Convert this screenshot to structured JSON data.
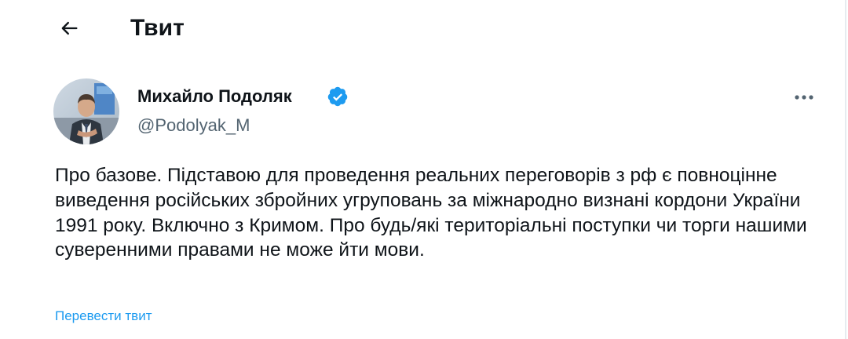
{
  "header": {
    "title": "Твит",
    "back_icon": "arrow-left-icon"
  },
  "author": {
    "name": "Михайло Подоляк",
    "handle": "@Podolyak_M",
    "verified": true,
    "verified_icon": "verified-badge-icon",
    "verified_color": "#1d9bf0",
    "avatar_icon": "avatar-photo"
  },
  "tweet": {
    "text": "Про базове. Підставою для проведення реальних переговорів з рф є повноцінне виведення російських збройних угруповань за міжнародно визнані кордони України 1991 року. Включно з Кримом. Про будь/які територіальні поступки чи торги нашими суверенними правами не може йти мови.",
    "translate_label": "Перевести твит",
    "more_icon": "more-horizontal-icon"
  },
  "colors": {
    "text": "#0f1419",
    "secondary": "#536471",
    "link": "#1d9bf0",
    "border": "#e6ecf0"
  }
}
